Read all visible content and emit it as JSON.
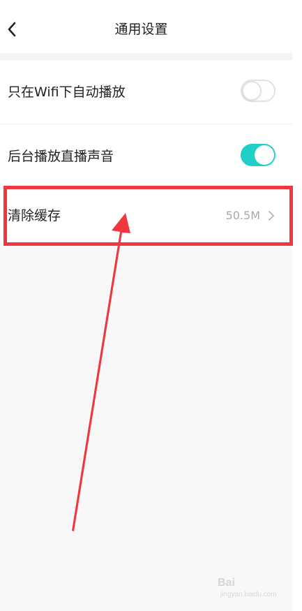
{
  "header": {
    "title": "通用设置",
    "back_icon": "chevron-left-icon"
  },
  "settings": {
    "wifi_autoplay": {
      "label": "只在Wifi下自动播放",
      "enabled": false
    },
    "background_audio": {
      "label": "后台播放直播声音",
      "enabled": true
    },
    "clear_cache": {
      "label": "清除缓存",
      "value": "50.5M",
      "icon": "chevron-right-icon"
    }
  },
  "annotation": {
    "highlight_color": "#f0373f"
  },
  "watermark": {
    "text": "Bai",
    "sub": "jingyan.baidu.com"
  },
  "colors": {
    "accent": "#1fcfc8",
    "background": "#f8f8f8",
    "text": "#222222",
    "muted": "#a9a9a9"
  }
}
